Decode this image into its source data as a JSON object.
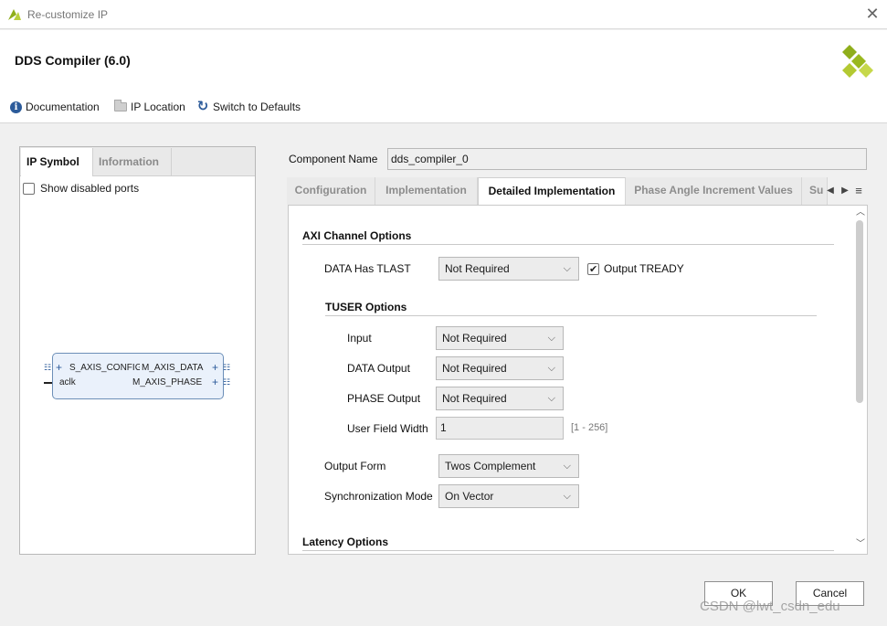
{
  "window": {
    "title": "Re-customize IP",
    "close_glyph": "✕"
  },
  "header": {
    "ip_title": "DDS Compiler (6.0)"
  },
  "toolbar": {
    "documentation": "Documentation",
    "ip_location": "IP Location",
    "switch_defaults": "Switch to Defaults"
  },
  "left_panel": {
    "tabs": [
      "IP Symbol",
      "Information"
    ],
    "show_disabled_ports": "Show disabled ports",
    "ports": {
      "s_axis_config": "S_AXIS_CONFIG",
      "aclk": "aclk",
      "m_axis_data": "M_AXIS_DATA",
      "m_axis_phase": "M_AXIS_PHASE"
    }
  },
  "component": {
    "label": "Component Name",
    "value": "dds_compiler_0"
  },
  "tabs": [
    "Configuration",
    "Implementation",
    "Detailed Implementation",
    "Phase Angle Increment Values",
    "Su"
  ],
  "content": {
    "axi_channel_options": "AXI Channel Options",
    "data_has_tlast": {
      "label": "DATA Has TLAST",
      "value": "Not Required"
    },
    "output_tready": {
      "label": "Output TREADY",
      "checked": true
    },
    "tuser_options": "TUSER Options",
    "input": {
      "label": "Input",
      "value": "Not Required"
    },
    "data_output": {
      "label": "DATA Output",
      "value": "Not Required"
    },
    "phase_output": {
      "label": "PHASE Output",
      "value": "Not Required"
    },
    "user_field_width": {
      "label": "User Field Width",
      "value": "1",
      "range": "[1 - 256]"
    },
    "output_form": {
      "label": "Output Form",
      "value": "Twos Complement"
    },
    "sync_mode": {
      "label": "Synchronization Mode",
      "value": "On Vector"
    },
    "latency_options": "Latency Options"
  },
  "buttons": {
    "ok": "OK",
    "cancel": "Cancel"
  },
  "watermark": "CSDN @lwt_csdn_edu",
  "colors": {
    "accent_blue": "#2c5b9a",
    "logo_green": "#9ab81f"
  }
}
